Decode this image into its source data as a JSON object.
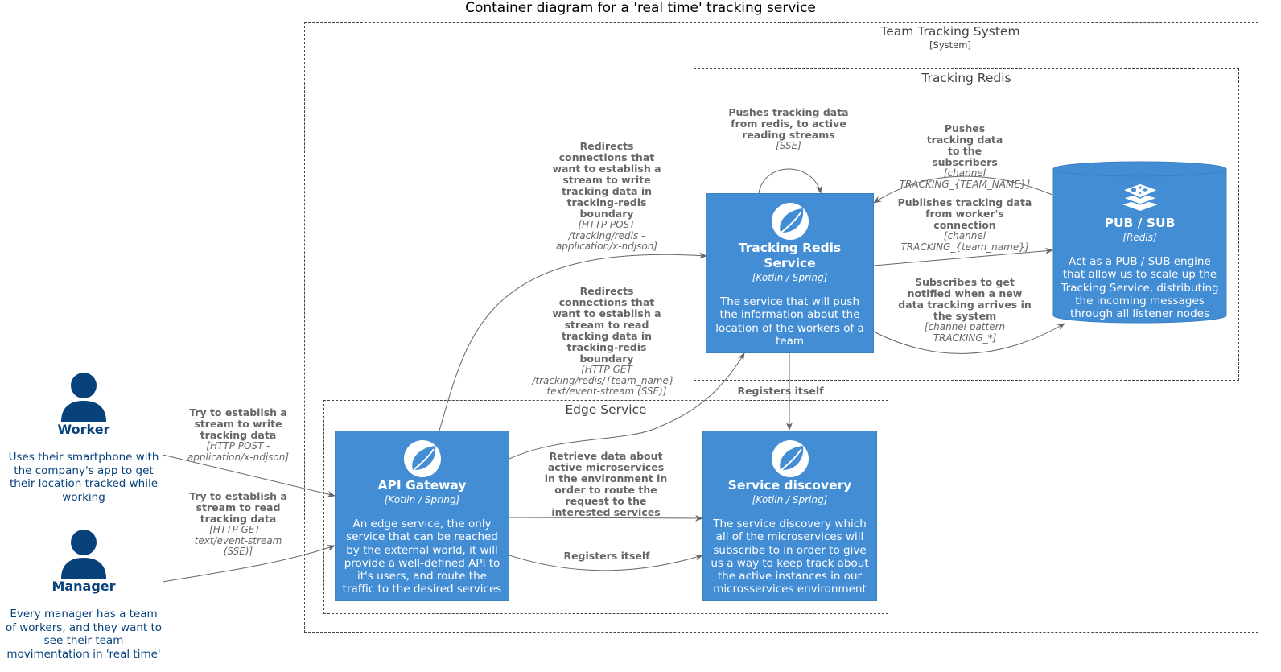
{
  "title": "Container diagram for a 'real time' tracking service",
  "boundaries": {
    "system": {
      "label": "Team Tracking System",
      "type": "[System]"
    },
    "redis": {
      "label": "Tracking Redis"
    },
    "edge": {
      "label": "Edge Service"
    }
  },
  "persons": {
    "worker": {
      "name": "Worker",
      "description": "Uses their smartphone with the company's app to get their location tracked while working"
    },
    "manager": {
      "name": "Manager",
      "description": "Every manager has a team of workers, and they want to see their team movimentation in 'real time'"
    }
  },
  "containers": {
    "tracking_redis_service": {
      "name": "Tracking Redis Service",
      "tech": "[Kotlin / Spring]",
      "description": "The service that will push the information about the location of the workers of a team",
      "icon": "spring-leaf-icon"
    },
    "pubsub": {
      "name": "PUB / SUB",
      "tech": "[Redis]",
      "description": "Act as a PUB / SUB engine that allow us to scale up the Tracking Service, distributing the incoming messages through all listener nodes",
      "icon": "redis-icon"
    },
    "api_gateway": {
      "name": "API Gateway",
      "tech": "[Kotlin / Spring]",
      "description": "An edge service, the only service that can be reached by the external world, it will provide a well-defined API to it's users, and route the traffic to the desired services",
      "icon": "spring-leaf-icon"
    },
    "service_discovery": {
      "name": "Service discovery",
      "tech": "[Kotlin / Spring]",
      "description": "The service discovery which all of the microservices will subscribe to in order to give us a way to keep track about the active instances in our microsservices environment",
      "icon": "spring-leaf-icon"
    }
  },
  "relations": {
    "worker_to_gateway": {
      "label": "Try to establish a stream to write tracking data",
      "tech": "[HTTP POST - application/x-ndjson]"
    },
    "manager_to_gateway": {
      "label": "Try to establish a stream to read tracking data",
      "tech": "[HTTP GET - text/event-stream (SSE)]"
    },
    "gateway_redirect_write": {
      "label": "Redirects connections that want to establish a stream to write tracking data in tracking-redis boundary",
      "tech": "[HTTP POST /tracking/redis - application/x-ndjson]"
    },
    "gateway_redirect_read": {
      "label": "Redirects connections that want to establish a stream to read tracking data in tracking-redis boundary",
      "tech": "[HTTP GET /tracking/redis/{team_name} - text/event-stream (SSE)]"
    },
    "self_push": {
      "label": "Pushes tracking data from redis, to active reading streams",
      "tech": "[SSE]"
    },
    "pubsub_push": {
      "label": "Pushes tracking data to the subscribers",
      "tech": "[channel TRACKING_{TEAM_NAME}]"
    },
    "publishes": {
      "label": "Publishes tracking data from worker's connection",
      "tech": "[channel TRACKING_{team_name}]"
    },
    "subscribes": {
      "label": "Subscribes to get notified when a new data tracking arrives in the system",
      "tech": "[channel pattern TRACKING_*]"
    },
    "redis_registers": {
      "label": "Registers itself"
    },
    "gateway_retrieve": {
      "label": "Retrieve data about active microservices in the environment in order to route the request to the interested services"
    },
    "gateway_registers": {
      "label": "Registers itself"
    }
  },
  "colors": {
    "container": "#438DD5",
    "person": "#08427B",
    "relation": "#666666"
  }
}
